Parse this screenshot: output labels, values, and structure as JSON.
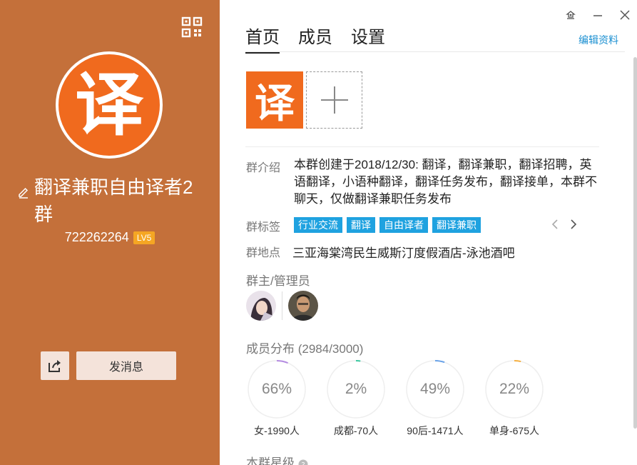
{
  "left": {
    "group_name": "翻译兼职自由译者2群",
    "group_id": "722262264",
    "level_badge": "LV5",
    "avatar_char": "译",
    "send_message_label": "发消息",
    "accent_bg": "#c4703a"
  },
  "tabs": [
    {
      "label": "首页"
    },
    {
      "label": "成员"
    },
    {
      "label": "设置"
    }
  ],
  "edit_profile_label": "编辑资料",
  "photo_char": "译",
  "intro": {
    "label": "群介绍",
    "text": "本群创建于2018/12/30: 翻译，翻译兼职，翻译招聘，英语翻译，小语种翻译，翻译任务发布，翻译接单，本群不聊天，仅做翻译兼职任务发布"
  },
  "tags_section": {
    "label": "群标签",
    "tags": [
      "行业交流",
      "翻译",
      "自由译者",
      "翻译兼职"
    ]
  },
  "location_section": {
    "label": "群地点",
    "text": "三亚海棠湾民生威斯汀度假酒店-泳池酒吧"
  },
  "admins_title": "群主/管理员",
  "distribution": {
    "title": "成员分布",
    "count": "(2984/3000)",
    "items": [
      {
        "pct_text": "66%",
        "value": 0.66,
        "label": "女-1990人",
        "color": "#b48be0"
      },
      {
        "pct_text": "2%",
        "value": 0.02,
        "label": "成都-70人",
        "color": "#3cc7a0"
      },
      {
        "pct_text": "49%",
        "value": 0.49,
        "label": "90后-1471人",
        "color": "#6aa3e8"
      },
      {
        "pct_text": "22%",
        "value": 0.22,
        "label": "单身-675人",
        "color": "#f5b042"
      }
    ]
  },
  "star_title": "本群星级"
}
